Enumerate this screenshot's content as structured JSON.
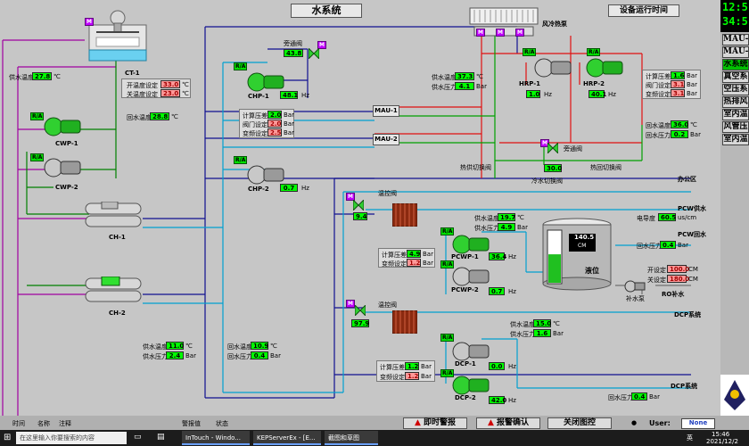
{
  "screen": {
    "title": "水系统",
    "runtime_button": "设备运行时间",
    "aircooled_label": "风冷热泵",
    "clock": {
      "time": "12:5",
      "sub": "34:5"
    }
  },
  "nav": [
    {
      "label": "MAU-1"
    },
    {
      "label": "MAU-2"
    },
    {
      "label": "水系统",
      "active": true
    },
    {
      "label": "真空系"
    },
    {
      "label": "空压系"
    },
    {
      "label": "热排风"
    },
    {
      "label": "室内温"
    },
    {
      "label": "风管压"
    },
    {
      "label": "室内温"
    }
  ],
  "tags": {
    "ra": "R/A",
    "m": "M"
  },
  "left": {
    "ct1": {
      "name": "CT-1"
    },
    "supply_temp": {
      "label": "供水温度",
      "value": "27.8",
      "unit": "℃"
    },
    "on_temp": {
      "label": "开温度设定",
      "value": "33.0",
      "unit": "℃"
    },
    "off_temp": {
      "label": "关温度设定",
      "value": "23.0",
      "unit": "℃"
    },
    "return_temp": {
      "label": "回水温度",
      "value": "28.8",
      "unit": "℃"
    },
    "cwp1": "CWP-1",
    "cwp2": "CWP-2",
    "ch1": "CH-1",
    "ch2": "CH-2",
    "bottom_supply_temp": {
      "label": "供水温度",
      "value": "11.0",
      "unit": "℃"
    },
    "bottom_supply_press": {
      "label": "供水压力",
      "value": "2.4",
      "unit": "Bar"
    },
    "bottom_return_temp": {
      "label": "回水温度",
      "value": "10.9",
      "unit": "℃"
    },
    "bottom_return_press": {
      "label": "回水压力",
      "value": "0.4",
      "unit": "Bar"
    }
  },
  "chp": {
    "bypass_label": "旁通阀",
    "bypass_value": "43.8",
    "chp1": "CHP-1",
    "chp1_hz": "48.1",
    "chp2": "CHP-2",
    "chp2_hz": "0.7",
    "hz": "Hz",
    "calc_diff": {
      "label": "计算压差",
      "value": "2.0",
      "unit": "Bar"
    },
    "valve_set": {
      "label": "阀门设定",
      "value": "2.0",
      "unit": "Bar"
    },
    "vfd_set": {
      "label": "变频设定",
      "value": "2.5",
      "unit": "Bar"
    }
  },
  "mau": {
    "mau1": "MAU-1",
    "mau2": "MAU-2"
  },
  "hrp": {
    "supply_temp": {
      "label": "供水温度",
      "value": "37.3",
      "unit": "℃"
    },
    "supply_press": {
      "label": "供水压力",
      "value": "4.1",
      "unit": "Bar"
    },
    "hrp1": "HRP-1",
    "hrp1_hz": "1.0",
    "hrp2": "HRP-2",
    "hrp2_hz": "40.1",
    "hz": "Hz",
    "calc_diff": {
      "label": "计算压差",
      "value": "1.6",
      "unit": "Bar"
    },
    "valve_set": {
      "label": "阀门设定",
      "value": "3.1",
      "unit": "Bar"
    },
    "vfd_set": {
      "label": "变频设定",
      "value": "3.1",
      "unit": "Bar"
    },
    "return_temp": {
      "label": "回水温度",
      "value": "36.0",
      "unit": "℃"
    },
    "return_press": {
      "label": "回水压力",
      "value": "0.2",
      "unit": "Bar"
    },
    "bypass_label": "旁通阀",
    "bypass_value": "30.0",
    "heat_supply_valve": "热供切换阀",
    "heat_return_valve": "热回切换阀",
    "cold_supply_valve": "冷水切换阀",
    "office": "办公区"
  },
  "pcw": {
    "ctrl_valve": "温控阀",
    "ctrl_value": "9.4",
    "supply_temp": {
      "label": "供水温度",
      "value": "19.7",
      "unit": "℃"
    },
    "supply_press": {
      "label": "供水压力",
      "value": "4.9",
      "unit": "Bar"
    },
    "pcw_supply": "PCW供水",
    "pcw_return": "PCW回水",
    "conductivity": {
      "label": "电导度",
      "value": "60.5",
      "unit": "us/cm"
    },
    "return_press": {
      "label": "回水压力",
      "value": "0.4",
      "unit": "Bar"
    },
    "pcwp1": "PCWP-1",
    "pcwp1_hz": "36.4",
    "pcwp2": "PCWP-2",
    "pcwp2_hz": "0.7",
    "hz": "Hz",
    "calc_diff": {
      "label": "计算压差",
      "value": "4.9",
      "unit": "Bar"
    },
    "vfd_set": {
      "label": "变频设定",
      "value": "1.2",
      "unit": "Bar"
    },
    "tank_value": "140.5",
    "tank_unit": "CM",
    "tank_label": "液位",
    "tank_level": 0.55,
    "open_set": {
      "label": "开设定",
      "value": "100.0",
      "unit": "CM"
    },
    "close_set": {
      "label": "关设定",
      "value": "180.0",
      "unit": "CM"
    },
    "makeup_pump": "补水泵",
    "ro_makeup": "RO补水"
  },
  "dcp": {
    "ctrl_valve": "温控阀",
    "ctrl_value": "97.9",
    "dcp_system": "DCP系统",
    "supply_temp": {
      "label": "供水温度",
      "value": "15.0",
      "unit": "℃"
    },
    "supply_press": {
      "label": "供水压力",
      "value": "1.6",
      "unit": "Bar"
    },
    "dcp1": "DCP-1",
    "dcp1_hz": "0.0",
    "dcp2": "DCP-2",
    "dcp2_hz": "42.0",
    "hz": "Hz",
    "calc_diff": {
      "label": "计算压差",
      "value": "1.2",
      "unit": "Bar"
    },
    "vfd_set": {
      "label": "变频设定",
      "value": "1.2",
      "unit": "Bar"
    },
    "dcp_system2": "DCP系统",
    "return_press": {
      "label": "回水压力",
      "value": "0.4",
      "unit": "Bar"
    }
  },
  "bottom": {
    "instant_alarm": "即时警报",
    "alarm_ack": "报警确认",
    "close_graphic": "关闭图控",
    "user_label": "User:",
    "user_value": "None"
  },
  "status_bar": {
    "time": "时间",
    "name": "名称",
    "note": "注释",
    "priority": "警报值",
    "state": "状态"
  },
  "taskbar": {
    "search": "在这里输入你要搜索的内容",
    "app1": "InTouch - Windo...",
    "app2": "KEPServerEx - [E...",
    "app3": "截图和草图",
    "lang": "英",
    "time": "15:46",
    "date": "2021/12/2"
  }
}
